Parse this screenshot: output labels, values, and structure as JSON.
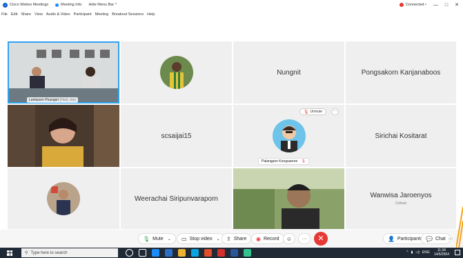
{
  "titlebar": {
    "app_name": "Cisco Webex Meetings",
    "meeting_info": "Meeting Info",
    "hide_menu": "Hide Menu Bar ^",
    "connection": "Connected •",
    "min": "—",
    "max": "□",
    "close": "✕"
  },
  "menubar": {
    "items": [
      "File",
      "Edit",
      "Share",
      "View",
      "Audio & Video",
      "Participant",
      "Meeting",
      "Breakout Sessions",
      "Help"
    ]
  },
  "tiles": {
    "leelasorn": {
      "name": "Leelasorn Poungsri",
      "host": "(Host, me)"
    },
    "nungnit": "Nungnit",
    "pongsakorn": "Pongsakorn Kanjanaboos",
    "scsaijai": "scsaijai15",
    "palangpon": {
      "name": "Palangpon Kongsaeree",
      "unmute": "Unmute",
      "more": "···"
    },
    "sirichai": "Sirichai Kositarat",
    "weerachai": "Weerachai Siripunvaraporn",
    "wanwisa": {
      "name": "Wanwisa Jaroenyos",
      "role": "Cohost"
    }
  },
  "toolbar": {
    "mute": "Mute",
    "stop_video": "Stop video",
    "share": "Share",
    "record": "Record",
    "more": "···",
    "end": "✕",
    "participants": "Participants",
    "chat": "Chat",
    "more2": "···"
  },
  "taskbar": {
    "search_placeholder": "Type here to search",
    "lang": "ENG",
    "time": "11:34",
    "date": "14/6/2564"
  },
  "colors": {
    "accent": "#2ea3f2",
    "end_call": "#e53935",
    "taskbar": "#1f2a36"
  }
}
